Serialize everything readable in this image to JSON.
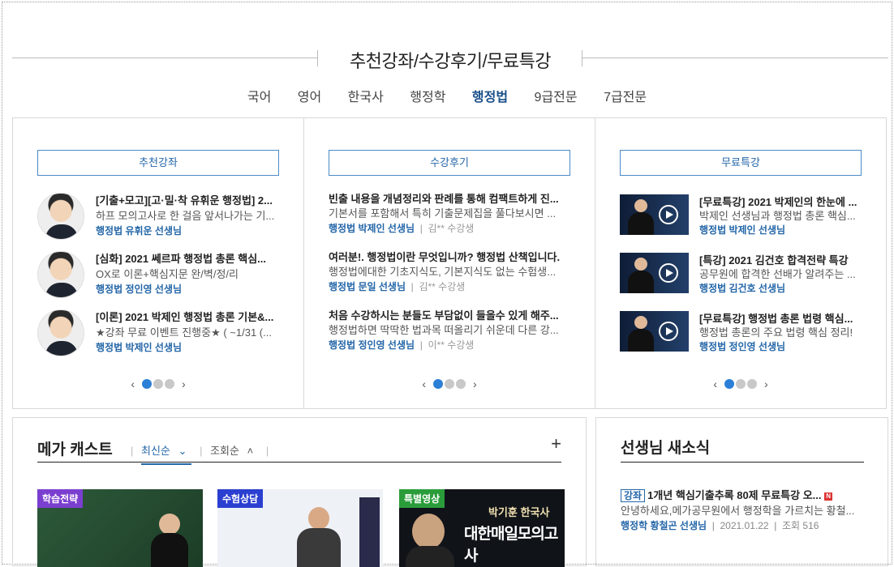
{
  "header": {
    "title": "추천강좌/수강후기/무료특강"
  },
  "tabs": [
    {
      "label": "국어"
    },
    {
      "label": "영어"
    },
    {
      "label": "한국사"
    },
    {
      "label": "행정학"
    },
    {
      "label": "행정법",
      "active": true
    },
    {
      "label": "9급전문"
    },
    {
      "label": "7급전문"
    }
  ],
  "recommended": {
    "heading": "추천강좌",
    "items": [
      {
        "title": "[기출+모고][고·밀·착 유휘운 행정법] 2...",
        "desc": "하프 모의고사로 한 걸음 앞서나가는 기...",
        "teacher": "행정법 유휘운 선생님"
      },
      {
        "title": "[심화] 2021 쎄르파 행정법 총론 핵심...",
        "desc": "OX로 이론+핵심지문 완/벽/정/리",
        "teacher": "행정법 정인영 선생님"
      },
      {
        "title": "[이론] 2021 박제인 행정법 총론 기본&...",
        "desc": "★강좌 무료 이벤트 진행중★ ( ~1/31 (...",
        "teacher": "행정법 박제인 선생님"
      }
    ]
  },
  "reviews": {
    "heading": "수강후기",
    "items": [
      {
        "title": "빈출 내용을 개념정리와 판례를 통해 컴팩트하게 진...",
        "desc": "기본서를 포함해서 특히 기출문제집을 풀다보시면 ...",
        "teacher": "행정법 박제인 선생님",
        "writer": "김** 수강생"
      },
      {
        "title": "여러분!. 행정법이란 무엇입니까? 행정법 산책입니다.",
        "desc": "행정법에대한 기초지식도, 기본지식도 없는 수험생...",
        "teacher": "행정법 문일 선생님",
        "writer": "김** 수강생"
      },
      {
        "title": "처음 수강하시는 분들도 부담없이 들을수 있게 해주...",
        "desc": "행정법하면 딱딱한 법과목 떠올리기 쉬운데 다른 강...",
        "teacher": "행정법 정인영 선생님",
        "writer": "이** 수강생"
      }
    ]
  },
  "free": {
    "heading": "무료특강",
    "items": [
      {
        "title": "[무료특강] 2021 박제인의 한눈에 ...",
        "desc": "박제인 선생님과 행정법 총론 핵심...",
        "teacher": "행정법 박제인 선생님"
      },
      {
        "title": "[특강] 2021 김건호 합격전략 특강",
        "desc": "공무원에 합격한 선배가 알려주는 ...",
        "teacher": "행정법 김건호 선생님"
      },
      {
        "title": "[무료특강] 행정법 총론 법령 핵심...",
        "desc": "행정법 총론의 주요 법령 핵심 정리!",
        "teacher": "행정법 정인영 선생님"
      }
    ]
  },
  "pager": {
    "prev": "‹",
    "next": "›"
  },
  "megacast": {
    "title": "메가 캐스트",
    "sort_latest": "최신순",
    "sort_views": "조회순",
    "more": "+",
    "videos": [
      {
        "tag": "학습전략",
        "tag_color": "#7b3fd0"
      },
      {
        "tag": "수험상담",
        "tag_color": "#2b3fd0"
      },
      {
        "tag": "특별영상",
        "tag_color": "#2a9d3a",
        "caption_top": "박기훈 한국사",
        "caption_main": "대한매일모의고사"
      }
    ]
  },
  "news": {
    "title": "선생님 새소식",
    "item": {
      "badge": "강좌",
      "title": "1개년 핵심기출추록 80제 무료특강 오...",
      "new": "N",
      "desc": "안녕하세요,메가공무원에서 행정학을 가르치는 황철...",
      "teacher": "행정학 황철곤 선생님",
      "date": "2021.01.22",
      "views": "조회 516"
    }
  },
  "colors": {
    "accent": "#2466a8",
    "dot_active": "#2b7fd6"
  }
}
